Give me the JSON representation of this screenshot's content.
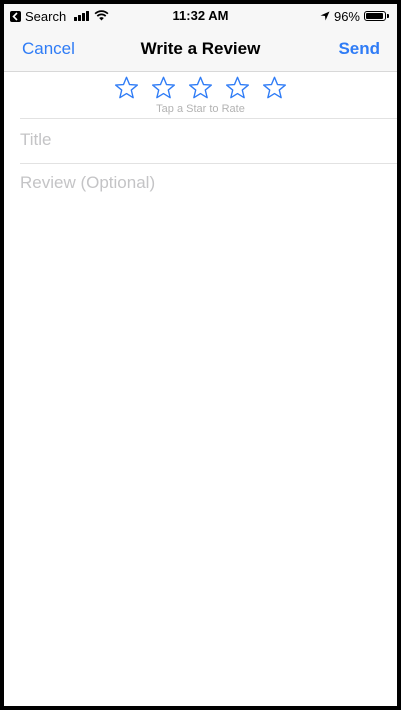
{
  "status_bar": {
    "back_app": "Search",
    "time": "11:32 AM",
    "battery": "96%",
    "battery_level": 0.96
  },
  "nav": {
    "cancel": "Cancel",
    "title": "Write a Review",
    "send": "Send"
  },
  "rating": {
    "stars": 5,
    "selected": 0,
    "hint": "Tap a Star to Rate",
    "star_color": "#2f7cf6"
  },
  "form": {
    "title_placeholder": "Title",
    "title_value": "",
    "review_placeholder": "Review (Optional)",
    "review_value": ""
  },
  "colors": {
    "accent": "#2f7cf6",
    "placeholder": "#c4c4c6",
    "hint": "#b3b3b3"
  },
  "icons": [
    "back-to-app-icon",
    "cellular-signal-icon",
    "wifi-icon",
    "location-arrow-icon",
    "battery-icon",
    "star-outline-icon"
  ]
}
